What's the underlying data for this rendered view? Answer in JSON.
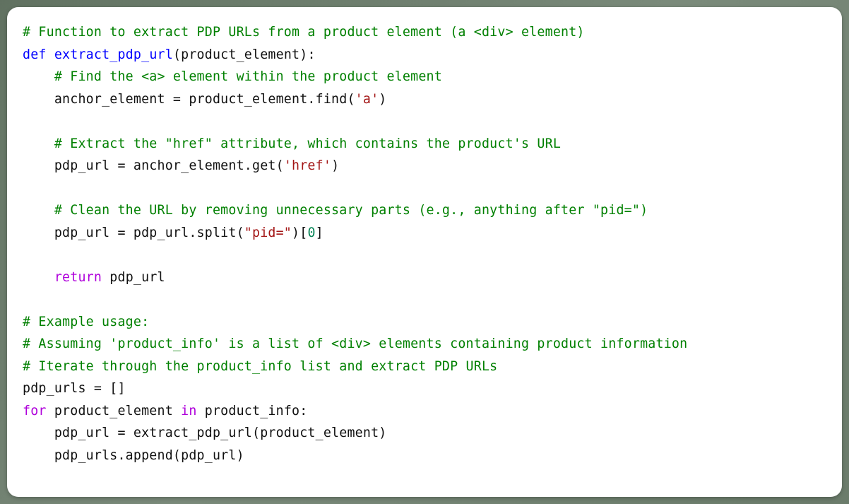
{
  "code": {
    "c1": "# Function to extract PDP URLs from a product element (a <div> element)",
    "def": "def",
    "fname": "extract_pdp_url",
    "params": "(product_element):",
    "c2": "# Find the <a> element within the product element",
    "l4a": "anchor_element = product_element.find(",
    "s1": "'a'",
    "l4b": ")",
    "c3": "# Extract the \"href\" attribute, which contains the product's URL",
    "l6a": "pdp_url = anchor_element.get(",
    "s2": "'href'",
    "l6b": ")",
    "c4": "# Clean the URL by removing unnecessary parts (e.g., anything after \"pid=\")",
    "l8a": "pdp_url = pdp_url.split(",
    "s3": "\"pid=\"",
    "l8b": ")[",
    "n0": "0",
    "l8c": "]",
    "ret": "return",
    "retv": " pdp_url",
    "c5": "# Example usage:",
    "c6": "# Assuming 'product_info' is a list of <div> elements containing product information",
    "c7": "# Iterate through the product_info list and extract PDP URLs",
    "l13": "pdp_urls = []",
    "for": "for",
    "l14a": " product_element ",
    "in": "in",
    "l14b": " product_info:",
    "l15": "pdp_url = extract_pdp_url(product_element)",
    "l16": "pdp_urls.append(pdp_url)"
  }
}
